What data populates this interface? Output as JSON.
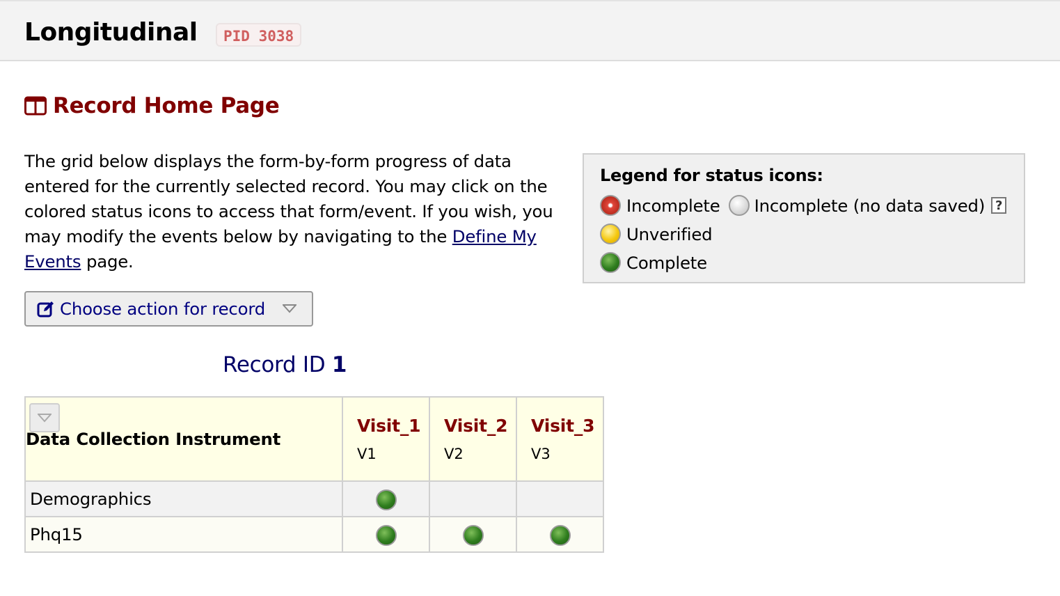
{
  "header": {
    "project_title": "Longitudinal",
    "pid_badge": "PID 3038"
  },
  "page": {
    "title": "Record Home Page",
    "title_icon": "columns-icon",
    "intro_text_1": "The grid below displays the form-by-form progress of data entered for the currently selected record. You may click on the colored status icons to access that form/event. If you wish, you may modify the events below by navigating to the ",
    "intro_link": "Define My Events",
    "intro_text_2": " page."
  },
  "legend": {
    "title": "Legend for status icons:",
    "items": [
      {
        "label": "Incomplete",
        "icon": "status-red-icon",
        "color": "#c0392b"
      },
      {
        "label": "Incomplete (no data saved)",
        "icon": "status-gray-icon",
        "color": "#d2d2d2"
      },
      {
        "label": "Unverified",
        "icon": "status-yellow-icon",
        "color": "#f5c80f"
      },
      {
        "label": "Complete",
        "icon": "status-green-icon",
        "color": "#2f7d1e"
      }
    ],
    "help_label": "?"
  },
  "actions": {
    "choose_action_label": "Choose action for record"
  },
  "record": {
    "label": "Record ID",
    "id": "1"
  },
  "grid": {
    "instrument_header": "Data Collection Instrument",
    "events": [
      {
        "name": "Visit_1",
        "sub": "V1"
      },
      {
        "name": "Visit_2",
        "sub": "V2"
      },
      {
        "name": "Visit_3",
        "sub": "V3"
      }
    ],
    "rows": [
      {
        "instrument": "Demographics",
        "status": [
          "complete",
          null,
          null
        ]
      },
      {
        "instrument": "Phq15",
        "status": [
          "complete",
          "complete",
          "complete"
        ]
      }
    ]
  },
  "colors": {
    "accent": "#800000",
    "link": "#000066",
    "header_bg": "#ffffe6"
  }
}
